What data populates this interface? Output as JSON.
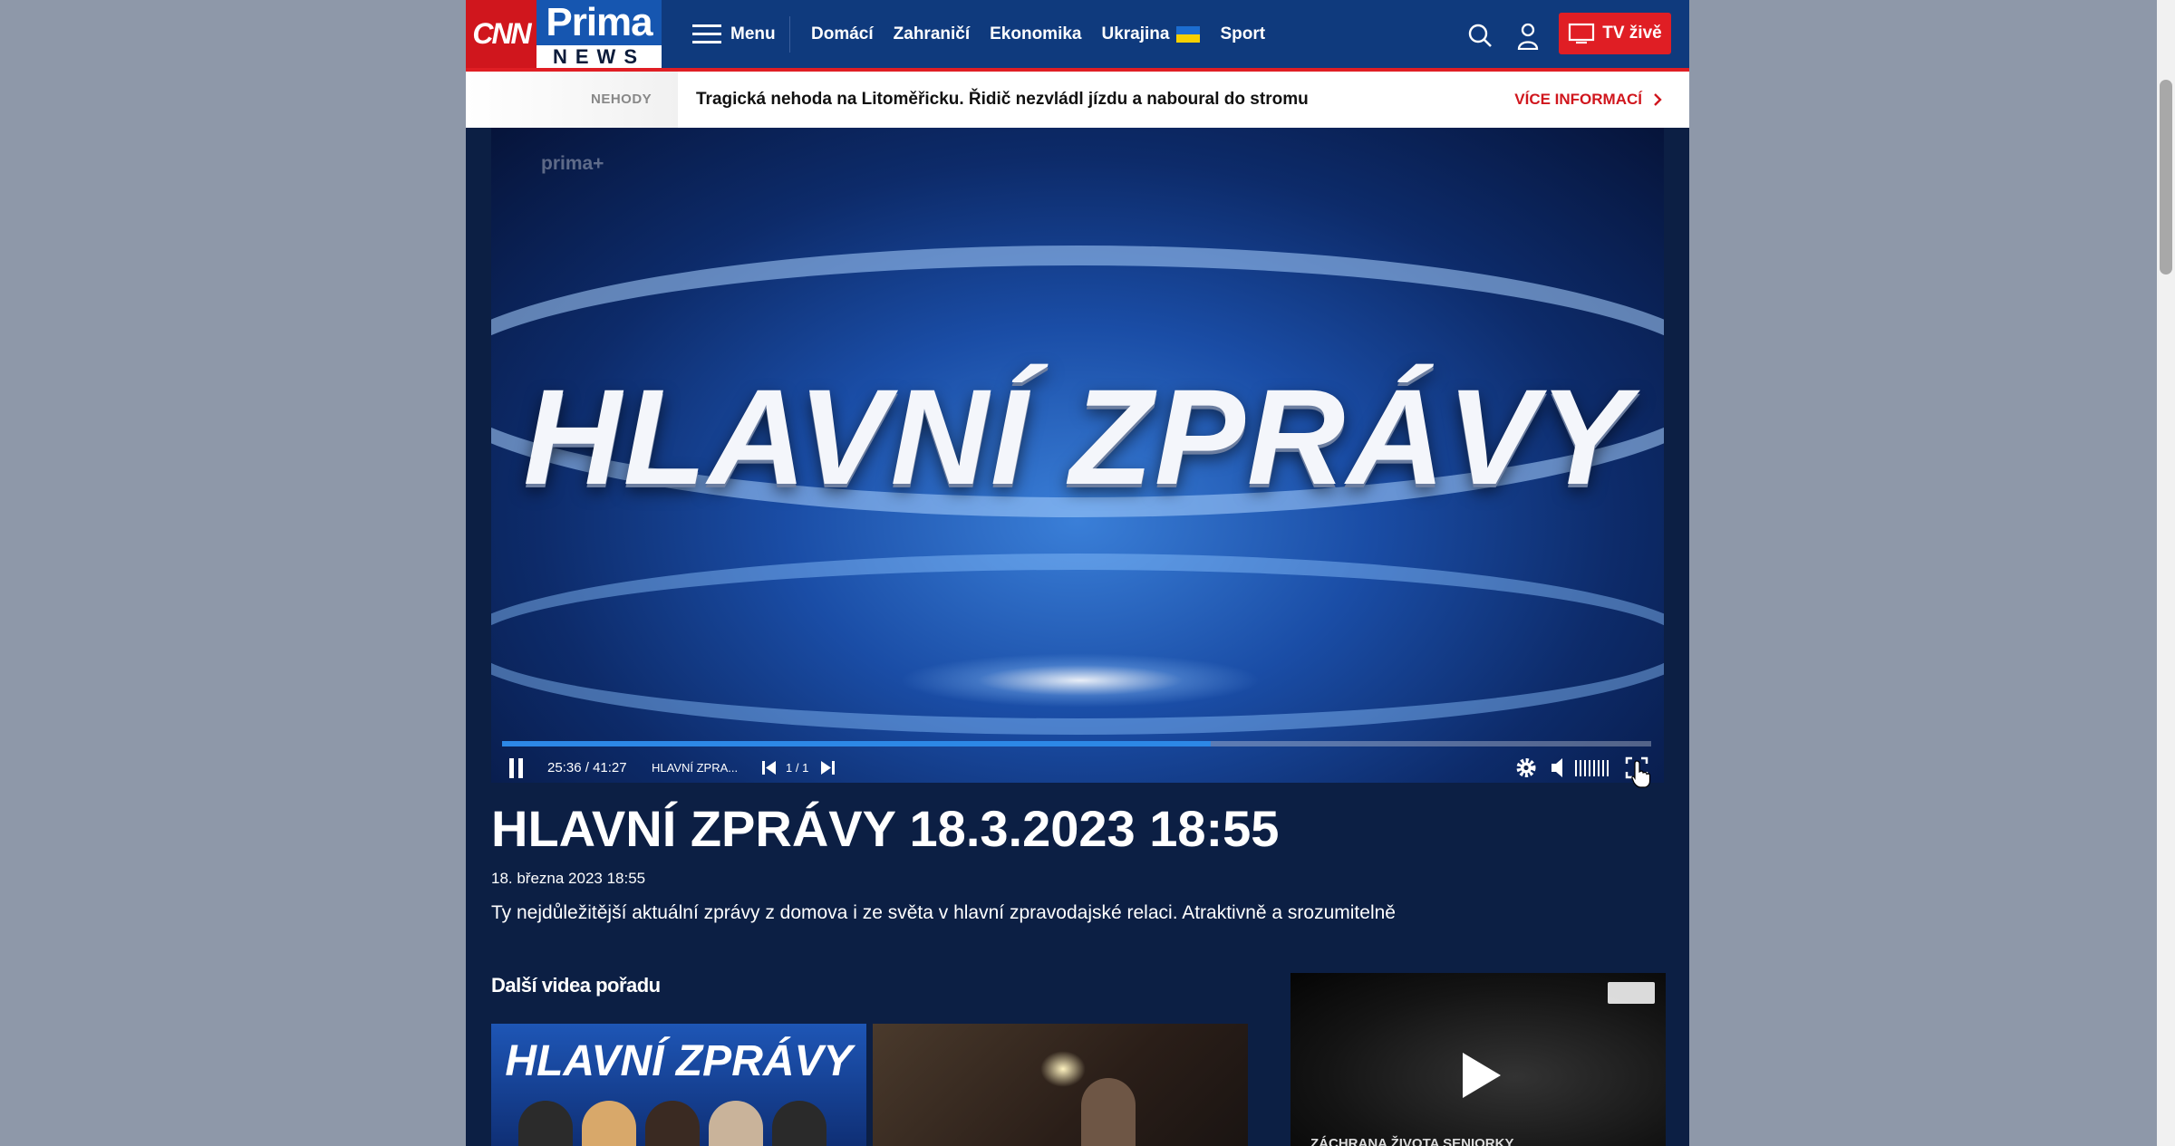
{
  "header": {
    "logo_cnn": "CNN",
    "logo_prima": "Prima",
    "logo_news": "NEWS",
    "menu_label": "Menu",
    "nav": [
      "Domácí",
      "Zahraničí",
      "Ekonomika",
      "Ukrajina",
      "Sport"
    ],
    "tv_label": "TV živě",
    "accent_color": "#e01e24",
    "nav_color": "#0f3a7d"
  },
  "breaking": {
    "label": "NEHODY",
    "headline": "Tragická nehoda na Litoměřicku. Řidič nezvládl jízdu a naboural do stromu",
    "more": "VÍCE INFORMACÍ"
  },
  "video": {
    "watermark": "prima+",
    "title_art": "HLAVNÍ ZPRÁVY",
    "time_current": "25:36",
    "time_sep": "/",
    "time_total": "41:27",
    "clip_title": "HLAVNÍ ZPRA...",
    "playlist_count": "1 / 1",
    "progress": 0.617
  },
  "article": {
    "title": "HLAVNÍ ZPRÁVY 18.3.2023 18:55",
    "date": "18. března 2023 18:55",
    "description": "Ty nejdůležitější aktuální zprávy z domova i ze světa v hlavní zpravodajské relaci. Atraktivně a srozumitelně"
  },
  "related": {
    "heading": "Další videa pořadu",
    "thumb1_text": "HLAVNÍ ZPRÁVY"
  },
  "ad": {
    "caption": "ZÁCHRANA ŽIVOTA SENIORKY"
  }
}
